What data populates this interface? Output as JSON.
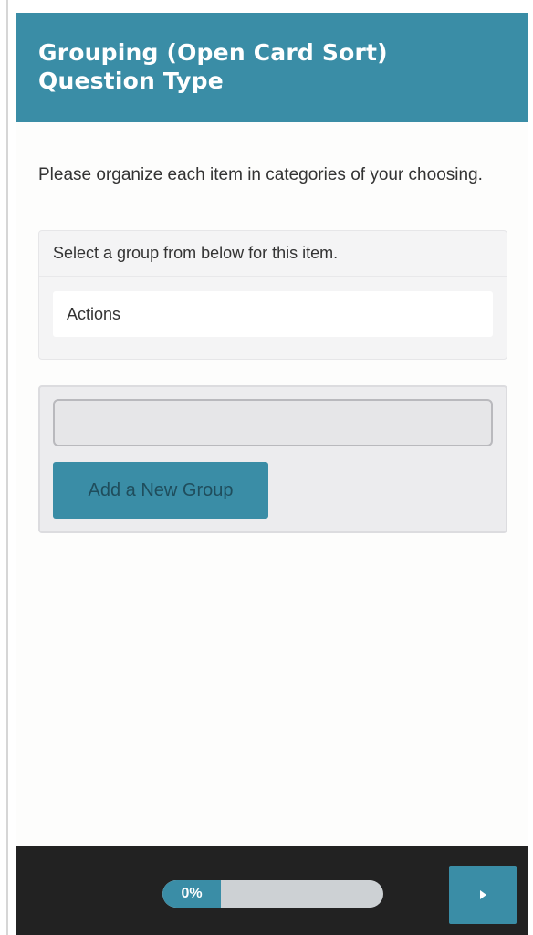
{
  "header": {
    "title": "Grouping (Open Card Sort) Question Type"
  },
  "question": {
    "prompt": "Please organize each item in categories of your choosing."
  },
  "item_panel": {
    "instruction": "Select a group from below for this item.",
    "current_item": "Actions"
  },
  "group_panel": {
    "input_value": "",
    "input_placeholder": "",
    "add_button_label": "Add a New Group"
  },
  "footer": {
    "progress_label": "0%",
    "progress_value": 0,
    "next_icon": "play-triangle-icon"
  },
  "colors": {
    "accent": "#3a8da6",
    "footer_bg": "#222222",
    "text": "#333333"
  }
}
